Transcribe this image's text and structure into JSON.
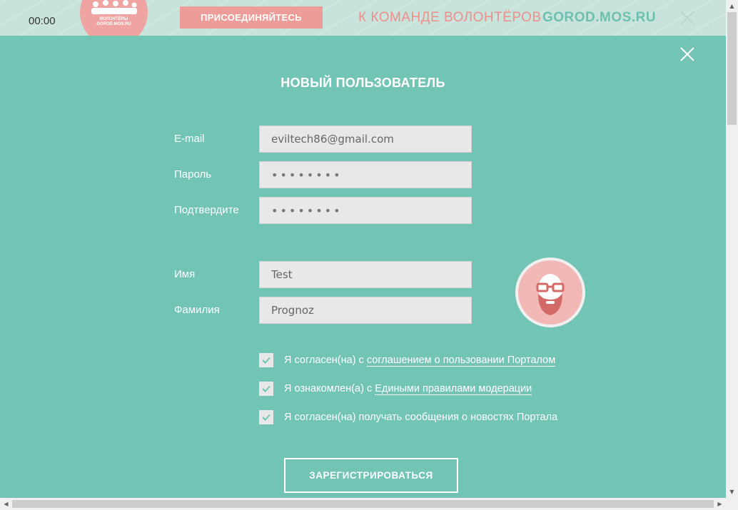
{
  "banner": {
    "timer": "00:00",
    "logo_line1": "ВОЛОНТЁРЫ",
    "logo_line2": "GOROD.MOS.RU",
    "join_label": "ПРИСОЕДИНЯЙТЕСЬ",
    "team_text": "К КОМАНДЕ ВОЛОНТЁРОВ",
    "site_text": "GOROD.MOS.RU",
    "close_icon": "close-icon"
  },
  "modal": {
    "title": "НОВЫЙ ПОЛЬЗОВАТЕЛЬ",
    "close_icon": "close-icon",
    "fields": {
      "email": {
        "label": "E-mail",
        "value": "eviltech86@gmail.com"
      },
      "password": {
        "label": "Пароль",
        "value": "••••••••"
      },
      "confirm": {
        "label": "Подтвердите",
        "value": "••••••••"
      },
      "first_name": {
        "label": "Имя",
        "value": "Test"
      },
      "last_name": {
        "label": "Фамилия",
        "value": "Prognoz"
      }
    },
    "avatar_icon": "avatar-icon",
    "checks": [
      {
        "prefix": "Я согласен(на) с ",
        "link": "соглашением о пользовании Порталом",
        "checked": true
      },
      {
        "prefix": "Я ознакомлен(а) с ",
        "link": "Едиными правилами модерации",
        "checked": true
      },
      {
        "prefix": "Я согласен(на) получать сообщения о новостях Портала",
        "link": "",
        "checked": true
      }
    ],
    "register_label": "ЗАРЕГИСТРИРОВАТЬСЯ"
  },
  "colors": {
    "background": "#72c4b4",
    "banner_bg": "#c8e3dc",
    "accent_pink": "#ec9c99",
    "accent_teal": "#6dbfaf",
    "input_bg": "#e8e8e8"
  }
}
